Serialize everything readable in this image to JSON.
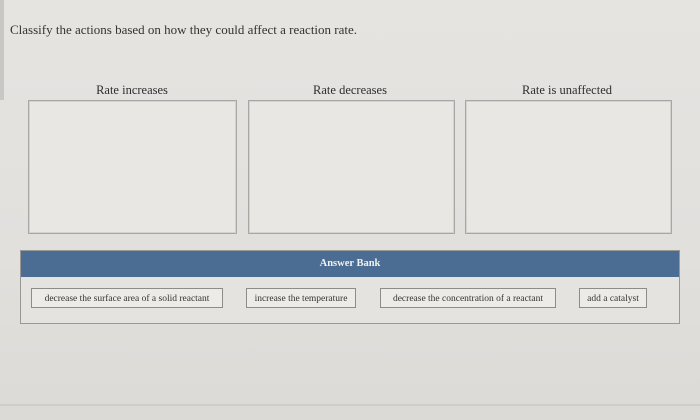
{
  "question": "Classify the actions based on how they could affect a reaction rate.",
  "categories": [
    {
      "label": "Rate increases"
    },
    {
      "label": "Rate decreases"
    },
    {
      "label": "Rate is unaffected"
    }
  ],
  "answer_bank": {
    "title": "Answer Bank",
    "items": [
      {
        "label": "decrease the surface area of a solid reactant"
      },
      {
        "label": "increase the temperature"
      },
      {
        "label": "decrease the concentration of a reactant"
      },
      {
        "label": "add a catalyst"
      }
    ]
  },
  "colors": {
    "header_bg": "#4b6c93",
    "background": "#e3e1de"
  }
}
